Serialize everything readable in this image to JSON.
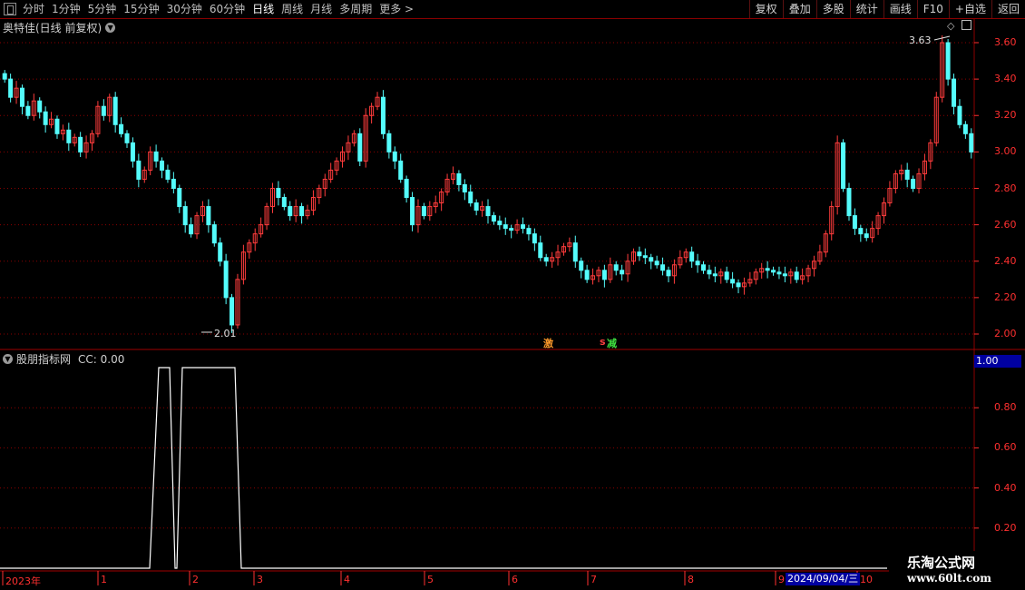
{
  "toolbar": {
    "periods": [
      "分时",
      "1分钟",
      "5分钟",
      "15分钟",
      "30分钟",
      "60分钟",
      "日线",
      "周线",
      "月线",
      "多周期",
      "更多"
    ],
    "active_period": "日线",
    "more_arrow": ">",
    "right_buttons": [
      "复权",
      "叠加",
      "多股",
      "统计",
      "画线",
      "F10",
      "+自选",
      "返回"
    ]
  },
  "main_chart": {
    "title": "奥特佳(日线 前复权)",
    "price_ticks": [
      "3.60",
      "3.40",
      "3.20",
      "3.00",
      "2.80",
      "2.60",
      "2.40",
      "2.20",
      "2.00"
    ],
    "high_label": "3.63",
    "low_label": "2.01",
    "signal_buy": "激",
    "signal_sell": "减",
    "signal_prefix": "s"
  },
  "indicator": {
    "title": "股朋指标网",
    "cc_text": "CC: 0.00",
    "ticks": [
      "0.80",
      "0.60",
      "0.40",
      "0.20"
    ],
    "current_value": "1.00"
  },
  "date_axis": {
    "labels": [
      "2023年",
      "1",
      "2",
      "3",
      "4",
      "5",
      "6",
      "7",
      "8",
      "9",
      "10"
    ],
    "cursor_date": "2024/09/04/三"
  },
  "watermark": {
    "title": "乐淘公式网",
    "url": "www.60lt.com"
  },
  "colors": {
    "up": "#ff3c3c",
    "down": "#54fcfc",
    "grid": "#8b0000"
  },
  "chart_data": {
    "type": "candlestick",
    "price_range": [
      2.0,
      3.65
    ],
    "closes": [
      3.4,
      3.3,
      3.35,
      3.25,
      3.2,
      3.28,
      3.22,
      3.15,
      3.18,
      3.1,
      3.12,
      3.05,
      3.08,
      3.0,
      3.05,
      3.1,
      3.25,
      3.2,
      3.3,
      3.15,
      3.1,
      3.05,
      2.95,
      2.85,
      2.9,
      3.0,
      2.95,
      2.9,
      2.85,
      2.8,
      2.7,
      2.6,
      2.55,
      2.65,
      2.7,
      2.6,
      2.5,
      2.4,
      2.2,
      2.05,
      2.3,
      2.45,
      2.5,
      2.55,
      2.6,
      2.7,
      2.8,
      2.75,
      2.7,
      2.65,
      2.7,
      2.65,
      2.68,
      2.75,
      2.8,
      2.85,
      2.9,
      2.95,
      3.0,
      3.05,
      3.1,
      2.95,
      3.2,
      3.25,
      3.3,
      3.1,
      3.0,
      2.95,
      2.85,
      2.75,
      2.6,
      2.7,
      2.65,
      2.7,
      2.72,
      2.78,
      2.85,
      2.88,
      2.82,
      2.78,
      2.72,
      2.68,
      2.7,
      2.65,
      2.62,
      2.6,
      2.58,
      2.57,
      2.6,
      2.58,
      2.55,
      2.5,
      2.42,
      2.4,
      2.42,
      2.45,
      2.48,
      2.5,
      2.4,
      2.35,
      2.3,
      2.32,
      2.35,
      2.3,
      2.38,
      2.35,
      2.33,
      2.4,
      2.45,
      2.43,
      2.42,
      2.4,
      2.38,
      2.35,
      2.32,
      2.38,
      2.42,
      2.45,
      2.4,
      2.38,
      2.35,
      2.33,
      2.32,
      2.34,
      2.3,
      2.28,
      2.26,
      2.28,
      2.3,
      2.34,
      2.36,
      2.35,
      2.34,
      2.33,
      2.32,
      2.34,
      2.3,
      2.32,
      2.36,
      2.4,
      2.45,
      2.55,
      2.7,
      3.05,
      2.8,
      2.65,
      2.58,
      2.55,
      2.53,
      2.58,
      2.65,
      2.72,
      2.8,
      2.88,
      2.9,
      2.85,
      2.8,
      2.88,
      2.95,
      3.05,
      3.3,
      3.6,
      3.4,
      3.25,
      3.15,
      3.1,
      3.0
    ]
  },
  "indicator_data": {
    "type": "line",
    "y_range": [
      0,
      1
    ],
    "points": [
      [
        0,
        0
      ],
      [
        165,
        0
      ],
      [
        175,
        1
      ],
      [
        187,
        1
      ],
      [
        193,
        0
      ],
      [
        195,
        0
      ],
      [
        201,
        1
      ],
      [
        259,
        1
      ],
      [
        266,
        0
      ],
      [
        978,
        0
      ]
    ]
  }
}
